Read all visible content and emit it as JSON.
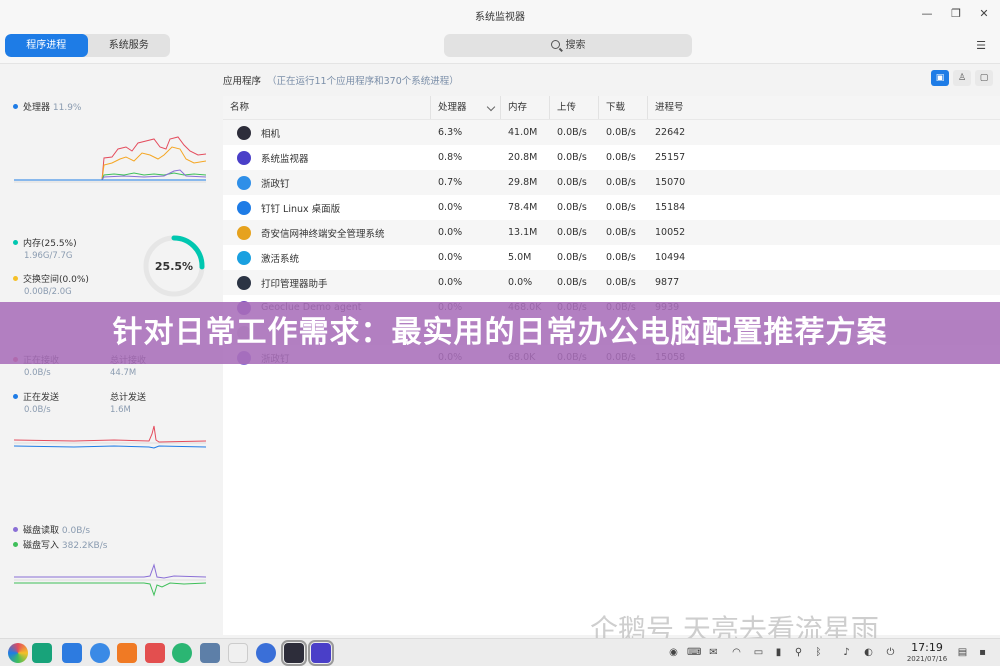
{
  "window": {
    "title": "系统监视器"
  },
  "toolbar": {
    "tabs": [
      "程序进程",
      "系统服务"
    ],
    "search_placeholder": "搜索"
  },
  "left": {
    "cpu": {
      "label": "处理器",
      "value": "11.9%",
      "color": "#1e7ce6"
    },
    "memory": {
      "label": "内存(25.5%)",
      "detail": "1.96G/7.7G",
      "color": "#00c7b0",
      "ring_percent": 25.5,
      "ring_label": "25.5%"
    },
    "swap": {
      "label": "交换空间(0.0%)",
      "detail": "0.00B/2.0G",
      "color": "#f5c028"
    },
    "net_recv": {
      "label": "正在接收",
      "value": "0.0B/s",
      "total_label": "总计接收",
      "total": "44.7M",
      "color": "#e44b5c"
    },
    "net_send": {
      "label": "正在发送",
      "value": "0.0B/s",
      "total_label": "总计发送",
      "total": "1.6M",
      "color": "#1e7ce6"
    },
    "disk_read": {
      "label": "磁盘读取",
      "value": "0.0B/s",
      "color": "#8a6fd6"
    },
    "disk_write": {
      "label": "磁盘写入",
      "value": "382.2KB/s",
      "color": "#3fbf5a"
    }
  },
  "main": {
    "header": "应用程序",
    "note": "（正在运行11个应用程序和370个系统进程）",
    "columns": [
      "名称",
      "处理器",
      "内存",
      "上传",
      "下载",
      "进程号"
    ],
    "rows": [
      {
        "name": "相机",
        "cpu": "6.3%",
        "mem": "41.0M",
        "up": "0.0B/s",
        "down": "0.0B/s",
        "pid": "22642",
        "icon": "camera-icon",
        "color": "#2d2d3a"
      },
      {
        "name": "系统监视器",
        "cpu": "0.8%",
        "mem": "20.8M",
        "up": "0.0B/s",
        "down": "0.0B/s",
        "pid": "25157",
        "icon": "monitor-icon",
        "color": "#4a3fc8"
      },
      {
        "name": "浙政钉",
        "cpu": "0.7%",
        "mem": "29.8M",
        "up": "0.0B/s",
        "down": "0.0B/s",
        "pid": "15070",
        "icon": "zzd-icon",
        "color": "#2f8fe8"
      },
      {
        "name": "钉钉 Linux 桌面版",
        "cpu": "0.0%",
        "mem": "78.4M",
        "up": "0.0B/s",
        "down": "0.0B/s",
        "pid": "15184",
        "icon": "dingtalk-icon",
        "color": "#1e7ce6"
      },
      {
        "name": "奇安信网神终端安全管理系统",
        "cpu": "0.0%",
        "mem": "13.1M",
        "up": "0.0B/s",
        "down": "0.0B/s",
        "pid": "10052",
        "icon": "qianxin-icon",
        "color": "#e6a21e"
      },
      {
        "name": "激活系统",
        "cpu": "0.0%",
        "mem": "5.0M",
        "up": "0.0B/s",
        "down": "0.0B/s",
        "pid": "10494",
        "icon": "activate-icon",
        "color": "#1aa0e0"
      },
      {
        "name": "打印管理器助手",
        "cpu": "0.0%",
        "mem": "0.0%",
        "up": "0.0B/s",
        "down": "0.0B/s",
        "pid": "9877",
        "icon": "printer-icon",
        "color": "#2b3444"
      },
      {
        "name": "Geoclue Demo agent",
        "cpu": "0.0%",
        "mem": "468.0K",
        "up": "0.0B/s",
        "down": "0.0B/s",
        "pid": "9939",
        "icon": "location-icon",
        "color": "#7a4fc0"
      },
      {
        "name": "",
        "cpu": "",
        "mem": "",
        "up": "",
        "down": "",
        "pid": "",
        "icon": "app-icon",
        "color": "#cfcfcf"
      },
      {
        "name": "浙政钉",
        "cpu": "0.0%",
        "mem": "68.0K",
        "up": "0.0B/s",
        "down": "0.0B/s",
        "pid": "15058",
        "icon": "zzd-icon",
        "color": "#8a6fd6"
      }
    ]
  },
  "banner": {
    "text": "针对日常工作需求：最实用的日常办公电脑配置推荐方案"
  },
  "watermark": {
    "text": "企鹅号 天亮去看流星雨"
  },
  "taskbar": {
    "time": "17:19",
    "date": "2021/07/16"
  }
}
